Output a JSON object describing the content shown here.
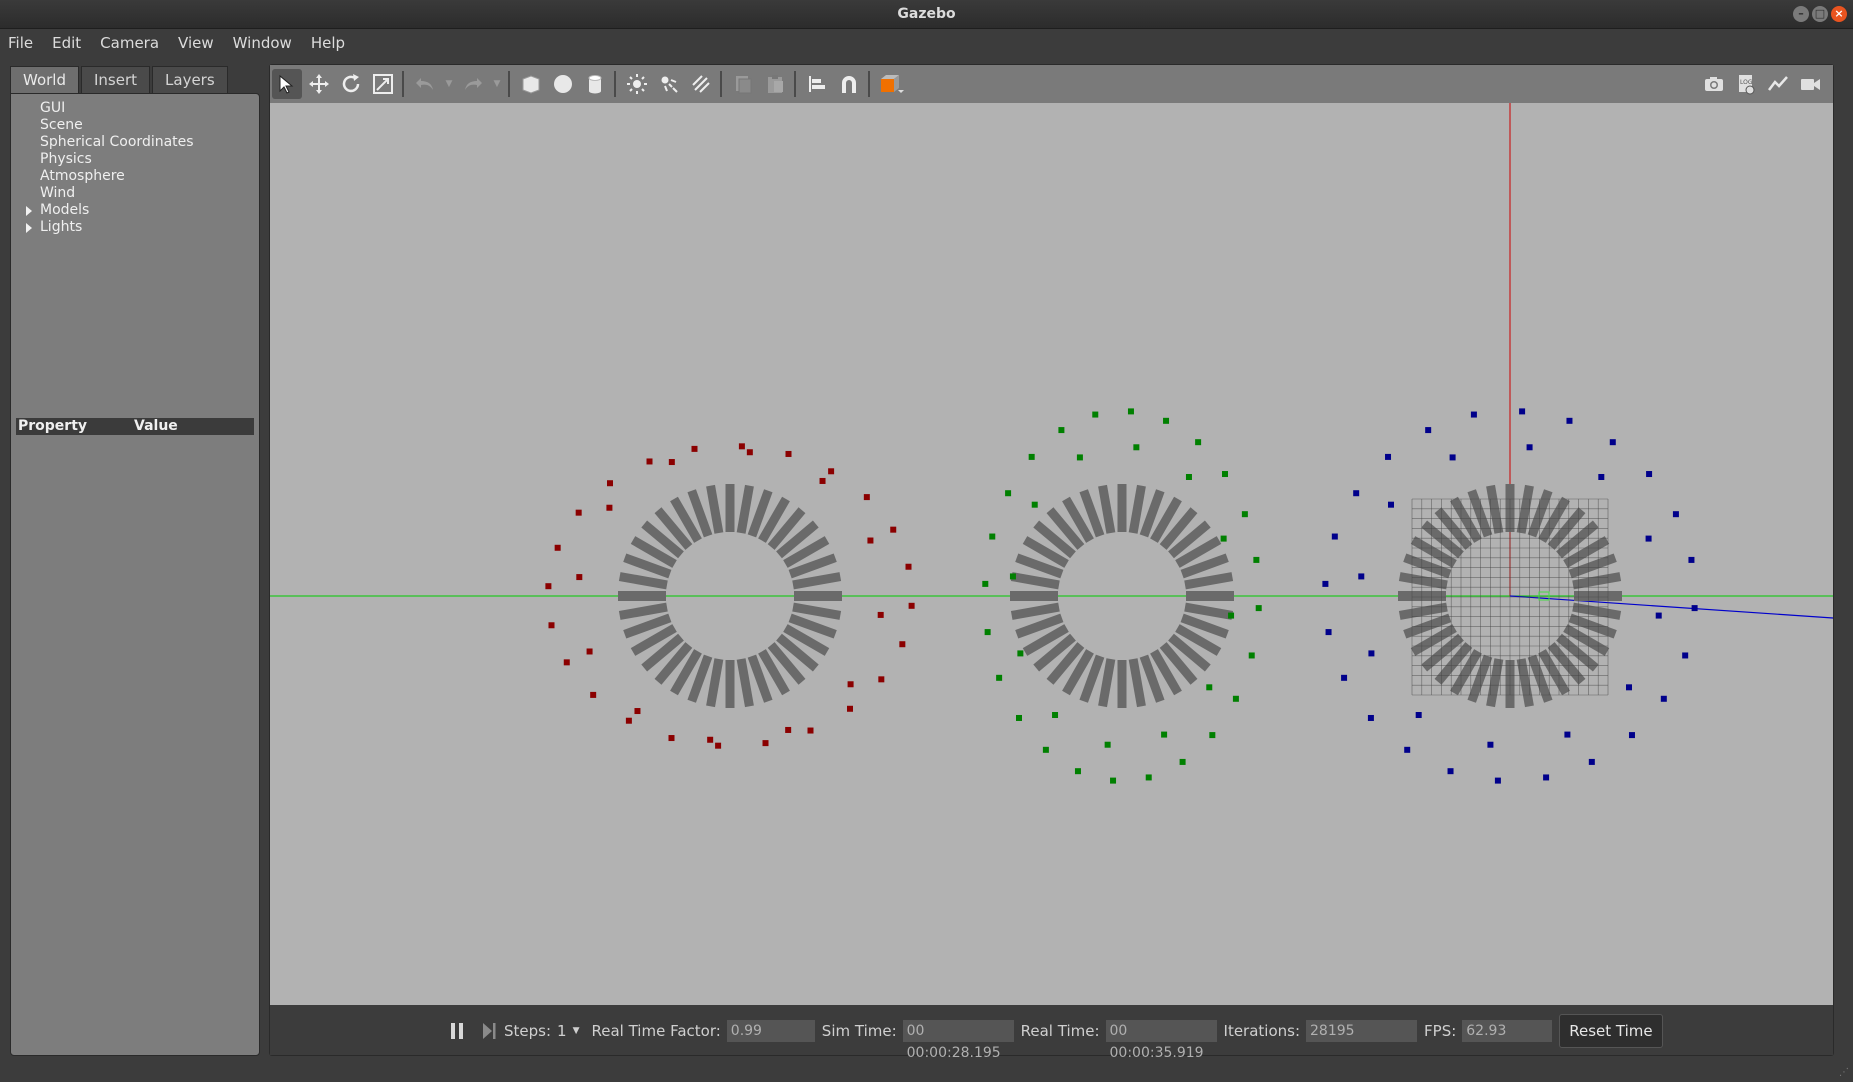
{
  "window": {
    "title": "Gazebo"
  },
  "menubar": {
    "items": [
      "File",
      "Edit",
      "Camera",
      "View",
      "Window",
      "Help"
    ]
  },
  "left_panel": {
    "tabs": [
      "World",
      "Insert",
      "Layers"
    ],
    "active_tab": "World",
    "tree": [
      {
        "label": "GUI",
        "expandable": false
      },
      {
        "label": "Scene",
        "expandable": false
      },
      {
        "label": "Spherical Coordinates",
        "expandable": false
      },
      {
        "label": "Physics",
        "expandable": false
      },
      {
        "label": "Atmosphere",
        "expandable": false
      },
      {
        "label": "Wind",
        "expandable": false
      },
      {
        "label": "Models",
        "expandable": true
      },
      {
        "label": "Lights",
        "expandable": true
      }
    ],
    "property_header": {
      "property": "Property",
      "value": "Value"
    }
  },
  "toolbar": {
    "left_tools": [
      "select-tool-icon",
      "translate-tool-icon",
      "rotate-tool-icon",
      "scale-tool-icon",
      "undo-icon",
      "redo-icon",
      "box-shape-icon",
      "sphere-shape-icon",
      "cylinder-shape-icon",
      "point-light-icon",
      "spot-light-icon",
      "directional-light-icon",
      "copy-icon",
      "paste-icon",
      "align-icon",
      "snap-icon",
      "view-angle-icon"
    ],
    "right_tools": [
      "screenshot-icon",
      "log-icon",
      "plot-icon",
      "video-record-icon"
    ]
  },
  "scene": {
    "background": "#b2b2b2",
    "axis_colors": {
      "x": "#0000cc",
      "y": "#00cc00",
      "z": "#cc0000"
    },
    "models": [
      {
        "color": "#8b0000"
      },
      {
        "color": "#008000"
      },
      {
        "color": "#00008b"
      }
    ]
  },
  "bottom_bar": {
    "steps_label": "Steps:",
    "steps_value": "1",
    "real_time_factor_label": "Real Time Factor:",
    "real_time_factor_value": "0.99",
    "sim_time_label": "Sim Time:",
    "sim_time_value": "00 00:00:28.195",
    "real_time_label": "Real Time:",
    "real_time_value": "00 00:00:35.919",
    "iterations_label": "Iterations:",
    "iterations_value": "28195",
    "fps_label": "FPS:",
    "fps_value": "62.93",
    "reset_button": "Reset Time"
  }
}
